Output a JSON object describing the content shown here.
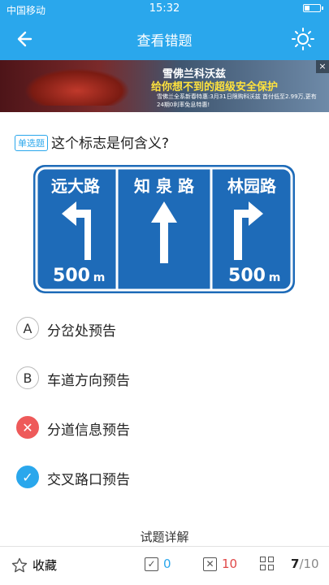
{
  "status_bar": {
    "carrier": "中国移动",
    "time": "15:32"
  },
  "header": {
    "title": "查看错题"
  },
  "banner": {
    "line1": "雪佛兰科沃兹",
    "line2": "给你想不到的超级安全保护",
    "line3": "雪佛兰全系新春特惠:3月31日限购科沃兹 首付低至2.99万,更有24期0利率免息特惠!",
    "close": "×"
  },
  "question": {
    "type_tag": "单选题",
    "text": "这个标志是何含义?"
  },
  "sign": {
    "panels": [
      {
        "name": "远大路",
        "distance": "500",
        "unit": "m",
        "arrow": "left"
      },
      {
        "name": "知 泉 路",
        "distance": "",
        "unit": "",
        "arrow": "straight"
      },
      {
        "name": "林园路",
        "distance": "500",
        "unit": "m",
        "arrow": "right"
      }
    ],
    "colors": {
      "background": "#1e6bb8",
      "border": "#ffffff"
    }
  },
  "options": [
    {
      "letter": "A",
      "text": "分岔处预告",
      "state": "normal"
    },
    {
      "letter": "B",
      "text": "车道方向预告",
      "state": "normal"
    },
    {
      "letter": "✕",
      "text": "分道信息预告",
      "state": "wrong"
    },
    {
      "letter": "✓",
      "text": "交叉路口预告",
      "state": "correct"
    }
  ],
  "explanation_label": "试题详解",
  "bottom_bar": {
    "favorite_label": "收藏",
    "correct_count": "0",
    "wrong_count": "10",
    "current": "7",
    "total": "/10"
  },
  "colors": {
    "accent": "#2aa7ec",
    "wrong": "#ee5a5a",
    "correct_count": "#2aa7ec",
    "wrong_count": "#e04848"
  }
}
